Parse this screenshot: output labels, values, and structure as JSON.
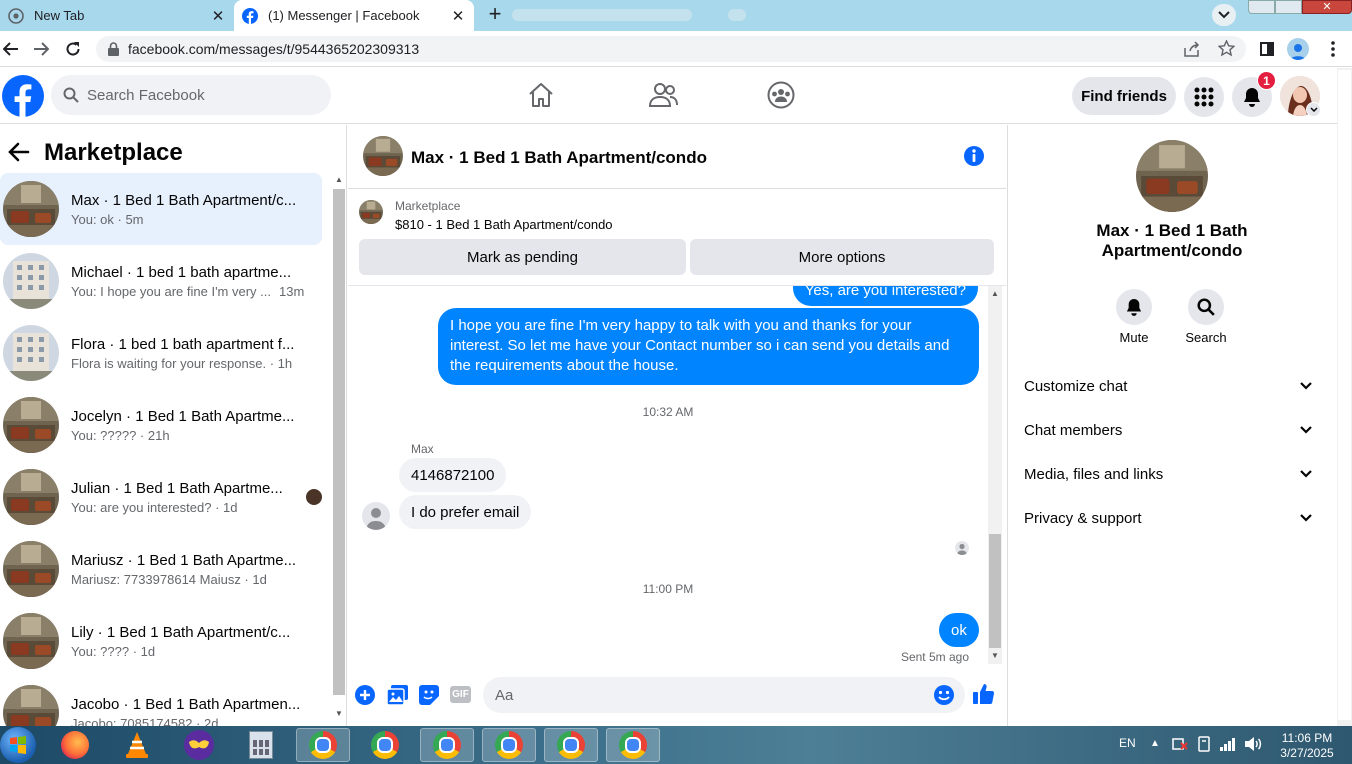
{
  "browser": {
    "tabs": [
      {
        "title": "New Tab"
      },
      {
        "title": "(1) Messenger | Facebook"
      }
    ],
    "url": "facebook.com/messages/t/9544365202309313"
  },
  "header": {
    "search_placeholder": "Search Facebook",
    "find_friends_label": "Find friends",
    "notification_count": "1"
  },
  "sidebar": {
    "title": "Marketplace",
    "conversations": [
      {
        "name": "Max · 1 Bed 1 Bath Apartment/c...",
        "preview": "You: ok · 5m",
        "avatar": "room"
      },
      {
        "name": "Michael · 1 bed 1 bath apartme...",
        "preview": "You: I hope you are fine I'm very ...",
        "time": "13m",
        "avatar": "building"
      },
      {
        "name": "Flora · 1 bed 1 bath apartment f...",
        "preview": "Flora is waiting for your response. · 1h",
        "avatar": "building"
      },
      {
        "name": "Jocelyn · 1 Bed 1 Bath Apartme...",
        "preview": "You: ????? · 21h",
        "avatar": "room"
      },
      {
        "name": "Julian · 1 Bed 1 Bath Apartme...",
        "preview": "You: are you interested? · 1d",
        "avatar": "room"
      },
      {
        "name": "Mariusz · 1 Bed 1 Bath Apartme...",
        "preview": "Mariusz: 7733978614 Maiusz · 1d",
        "avatar": "room"
      },
      {
        "name": "Lily · 1 Bed 1 Bath Apartment/c...",
        "preview": "You: ???? · 1d",
        "avatar": "room"
      },
      {
        "name": "Jacobo · 1 Bed 1 Bath Apartmen...",
        "preview": "Jacobo: 7085174582 · 2d",
        "avatar": "room"
      }
    ]
  },
  "chat": {
    "title": "Max · 1 Bed 1 Bath Apartment/condo",
    "marketplace_label": "Marketplace",
    "listing": "$810 - 1 Bed 1 Bath Apartment/condo",
    "mark_pending_label": "Mark as pending",
    "more_options_label": "More options",
    "messages": {
      "partial_out": "Yes, are you interested?",
      "long_out": "I hope you are fine I'm very happy to talk with you and thanks for your interest. So let me have your Contact number so i can send you details and the requirements about the house.",
      "time1": "10:32 AM",
      "sender": "Max",
      "in1": "4146872100",
      "in2": "I do prefer email",
      "time2": "11:00 PM",
      "out_ok": "ok",
      "status": "Sent 5m ago"
    },
    "input_placeholder": "Aa",
    "gif_label": "GIF"
  },
  "details": {
    "title": "Max · 1 Bed 1 Bath Apartment/condo",
    "mute_label": "Mute",
    "search_label": "Search",
    "sections": [
      "Customize chat",
      "Chat members",
      "Media, files and links",
      "Privacy & support"
    ]
  },
  "taskbar": {
    "language": "EN",
    "time": "11:06 PM",
    "date": "3/27/2025"
  },
  "colors": {
    "messenger_blue": "#0084ff",
    "facebook_blue": "#0866ff",
    "notification_red": "#e41e3f",
    "selected_row": "#e7f0fd"
  }
}
